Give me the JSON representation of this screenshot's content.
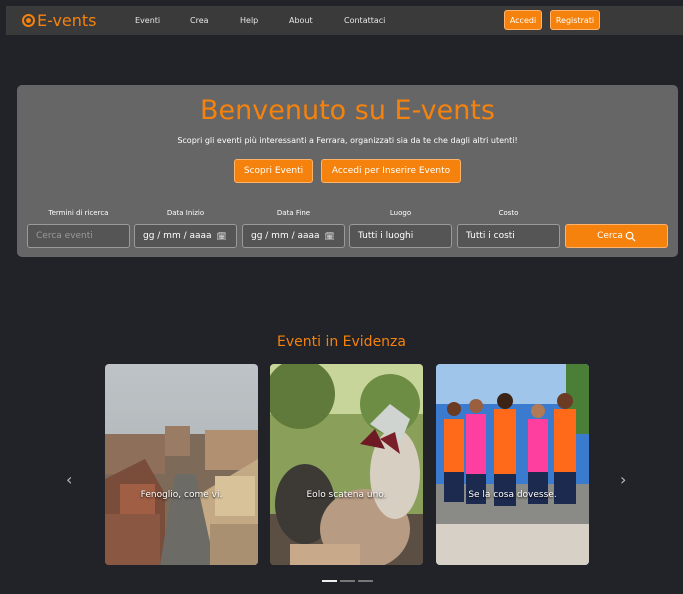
{
  "navbar": {
    "brand": "E-vents",
    "links": [
      "Eventi",
      "Crea",
      "Help",
      "About",
      "Contattaci"
    ],
    "login_label": "Accedi",
    "register_label": "Registrati"
  },
  "hero": {
    "title": "Benvenuto su E-vents",
    "subtitle": "Scopri gli eventi più interessanti a Ferrara, organizzati sia da te che dagli altri utenti!",
    "discover_label": "Scopri Eventi",
    "login_insert_label": "Accedi per Inserire Evento"
  },
  "search": {
    "labels": [
      "Termini di ricerca",
      "Data Inizio",
      "Data Fine",
      "Luogo",
      "Costo"
    ],
    "terms_placeholder": "Cerca eventi",
    "date_start_value": "gg / mm / aaaa",
    "date_end_value": "gg / mm / aaaa",
    "place_value": "Tutti i luoghi",
    "cost_value": "Tutti i costi",
    "button_label": "Cerca"
  },
  "featured": {
    "title": "Eventi in Evidenza",
    "cards": [
      {
        "caption": "Fenoglio, come vi."
      },
      {
        "caption": "Eolo scatena uno."
      },
      {
        "caption": "Se la cosa dovesse."
      }
    ],
    "prev_icon": "chevron-left-icon",
    "next_icon": "chevron-right-icon",
    "active_slide": 1,
    "slide_count": 3
  },
  "colors": {
    "accent": "#f5820d",
    "background": "#212328",
    "navbar": "#3a3a3a",
    "hero": "#666666"
  }
}
